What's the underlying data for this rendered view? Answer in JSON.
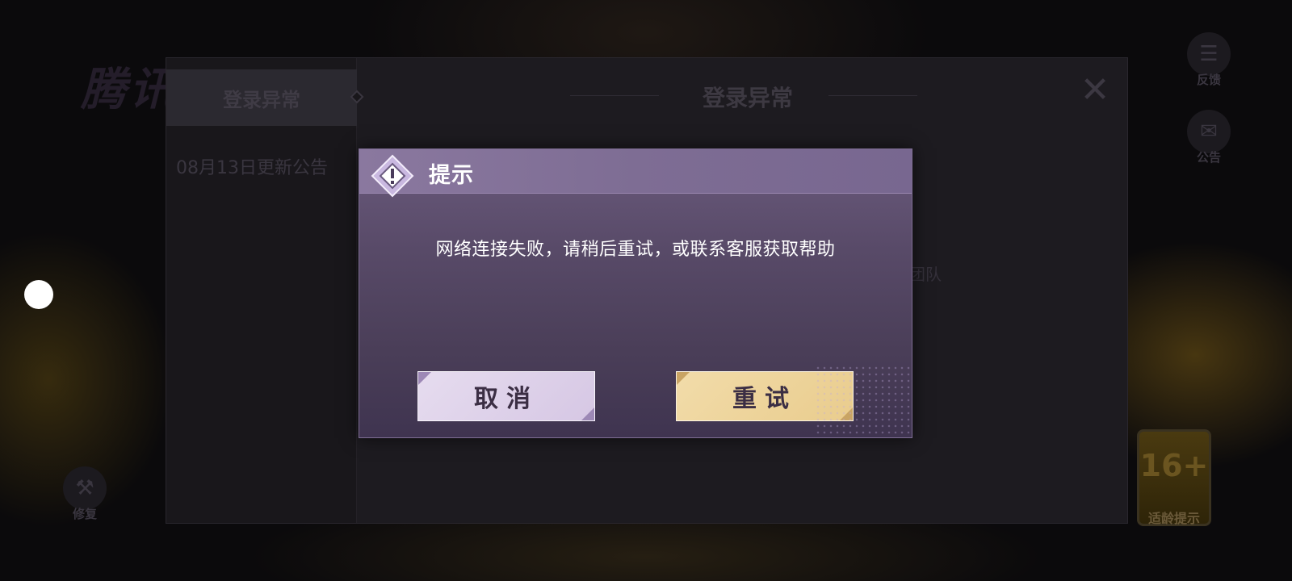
{
  "background": {
    "game_title": "腾讯",
    "side_buttons": {
      "feedback_label": "反馈",
      "announcement_label": "公告",
      "repair_label": "修复"
    },
    "age_badge": {
      "rating": "16+",
      "label": "适龄提示"
    }
  },
  "notice_panel": {
    "active_tab": "登录异常",
    "tab_items": [
      "08月13日更新公告"
    ],
    "header_title": "登录异常",
    "partial_body_text": "团队",
    "close_icon": "close-icon"
  },
  "dialog": {
    "title": "提示",
    "icon": "warning-icon",
    "message": "网络连接失败，请稍后重试，或联系客服获取帮助",
    "cancel_label": "取消",
    "retry_label": "重试",
    "colors": {
      "header": "#7e6d94",
      "body": "#584a68",
      "cancel_bg": "#dcd0e8",
      "retry_bg": "#ecd296"
    }
  }
}
